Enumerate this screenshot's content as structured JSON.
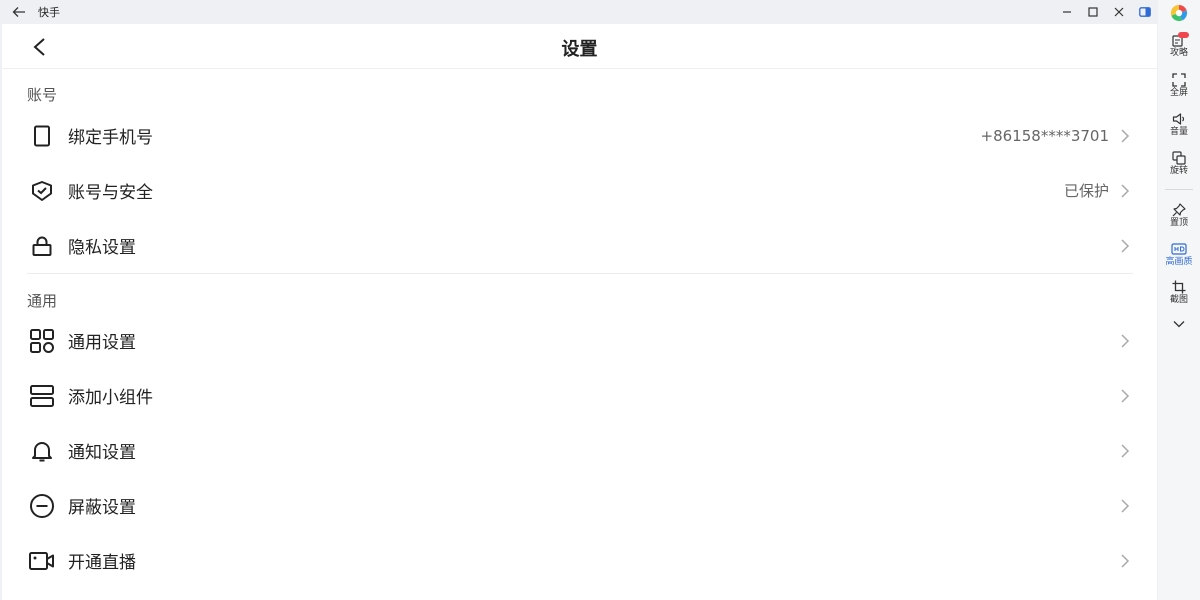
{
  "window": {
    "title": "快手"
  },
  "header": {
    "title": "设置"
  },
  "sections": [
    {
      "title": "账号",
      "items": [
        {
          "label": "绑定手机号",
          "value": "+86158****3701",
          "icon": "phone-icon"
        },
        {
          "label": "账号与安全",
          "value": "已保护",
          "icon": "shield-icon"
        },
        {
          "label": "隐私设置",
          "value": "",
          "icon": "lock-icon"
        }
      ]
    },
    {
      "title": "通用",
      "items": [
        {
          "label": "通用设置",
          "value": "",
          "icon": "grid-icon"
        },
        {
          "label": "添加小组件",
          "value": "",
          "icon": "widget-icon"
        },
        {
          "label": "通知设置",
          "value": "",
          "icon": "bell-icon"
        },
        {
          "label": "屏蔽设置",
          "value": "",
          "icon": "block-icon"
        },
        {
          "label": "开通直播",
          "value": "",
          "icon": "camera-icon"
        }
      ]
    }
  ],
  "sidebar": {
    "items": [
      {
        "label": "攻略",
        "icon": "guide-icon",
        "badge": "new"
      },
      {
        "label": "全屏",
        "icon": "fullscreen-icon"
      },
      {
        "label": "音量",
        "icon": "volume-icon"
      },
      {
        "label": "旋转",
        "icon": "rotate-icon"
      },
      {
        "label": "置顶",
        "icon": "pin-icon"
      },
      {
        "label": "高画质",
        "icon": "hd-icon",
        "active": true
      },
      {
        "label": "截图",
        "icon": "crop-icon"
      }
    ]
  },
  "colors": {
    "accent": "#2f6bd6",
    "badge": "#f0454f"
  }
}
